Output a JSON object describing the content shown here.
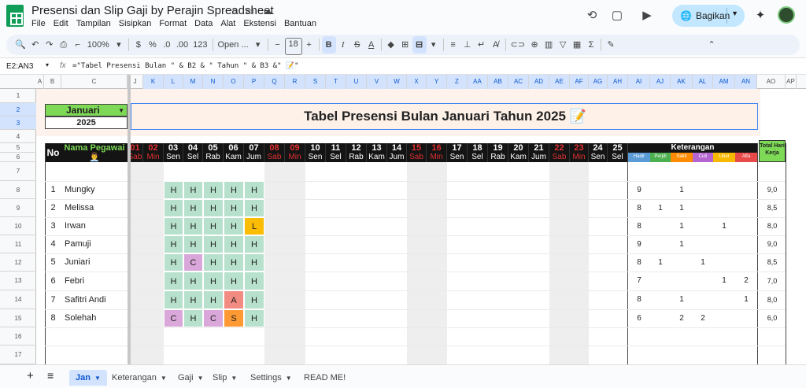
{
  "doc": {
    "title": "Presensi dan Slip Gaji by Perajin Spreadsheet"
  },
  "menu": [
    "File",
    "Edit",
    "Tampilan",
    "Sisipkan",
    "Format",
    "Data",
    "Alat",
    "Ekstensi",
    "Bantuan"
  ],
  "share": {
    "label": "Bagikan"
  },
  "toolbar": {
    "zoom": "100%",
    "currency": "$",
    "percent": "%",
    "dec_less": ".0",
    "dec_more": ".00",
    "number_format": "123",
    "font": "Open ...",
    "font_size": "18",
    "bold": "B"
  },
  "formula_bar": {
    "name_box": "E2:AN3",
    "formula": "=\"Tabel Presensi Bulan \" & B2 & \" Tahun \" & B3 &\" 📝\""
  },
  "columns": [
    "A",
    "B",
    "C",
    "J",
    "K",
    "L",
    "M",
    "N",
    "O",
    "P",
    "Q",
    "R",
    "S",
    "T",
    "U",
    "V",
    "W",
    "X",
    "Y",
    "Z",
    "AA",
    "AB",
    "AC",
    "AD",
    "AE",
    "AF",
    "AG",
    "AH",
    "AI",
    "AJ",
    "AK",
    "AL",
    "AM",
    "AN",
    "AO",
    "AP"
  ],
  "rows": [
    "1",
    "2",
    "3",
    "4",
    "5",
    "6",
    "7",
    "8",
    "9",
    "10",
    "11",
    "12",
    "13",
    "14",
    "15",
    "16",
    "17"
  ],
  "sheet": {
    "month": "Januari",
    "year": "2025",
    "title": "Tabel Presensi Bulan Januari Tahun 2025 📝",
    "no_header": "No",
    "name_header": "Nama Pegawai 👨‍💼",
    "days": [
      {
        "n": "01",
        "d": "Sab",
        "holiday": true
      },
      {
        "n": "02",
        "d": "Min",
        "holiday": true
      },
      {
        "n": "03",
        "d": "Sen"
      },
      {
        "n": "04",
        "d": "Sel"
      },
      {
        "n": "05",
        "d": "Rab"
      },
      {
        "n": "06",
        "d": "Kam"
      },
      {
        "n": "07",
        "d": "Jum"
      },
      {
        "n": "08",
        "d": "Sab",
        "holiday": true
      },
      {
        "n": "09",
        "d": "Min",
        "holiday": true
      },
      {
        "n": "10",
        "d": "Sen"
      },
      {
        "n": "11",
        "d": "Sel"
      },
      {
        "n": "12",
        "d": "Rab"
      },
      {
        "n": "13",
        "d": "Kam"
      },
      {
        "n": "14",
        "d": "Jum"
      },
      {
        "n": "15",
        "d": "Sab",
        "holiday": true
      },
      {
        "n": "16",
        "d": "Min",
        "holiday": true
      },
      {
        "n": "17",
        "d": "Sen"
      },
      {
        "n": "18",
        "d": "Sel"
      },
      {
        "n": "19",
        "d": "Rab"
      },
      {
        "n": "20",
        "d": "Kam"
      },
      {
        "n": "21",
        "d": "Jum"
      },
      {
        "n": "22",
        "d": "Sab",
        "holiday": true
      },
      {
        "n": "23",
        "d": "Min",
        "holiday": true
      },
      {
        "n": "24",
        "d": "Sen"
      },
      {
        "n": "25",
        "d": "Sel"
      }
    ],
    "keterangan": {
      "title": "Keterangan",
      "labels": [
        "Hadir",
        "Perjdl",
        "Sakit",
        "Cuti",
        "Libur",
        "Alfa"
      ],
      "colors": [
        "#5b9bd5",
        "#4caf50",
        "#ff8c00",
        "#b565d0",
        "#f7b800",
        "#e84a4a"
      ]
    },
    "total_header": "Total Hari Kerja",
    "code_colors": {
      "H": "#b7e1cd",
      "C": "#d9a7d9",
      "L": "#fbbc04",
      "A": "#f28b82",
      "S": "#ff9933"
    },
    "employees": [
      {
        "no": "1",
        "name": "Mungky",
        "marks": [
          "H",
          "H",
          "H",
          "H",
          "H"
        ],
        "ket": [
          "9",
          "",
          "1",
          "",
          "",
          ""
        ],
        "total": "9,0"
      },
      {
        "no": "2",
        "name": "Melissa",
        "marks": [
          "H",
          "H",
          "H",
          "H",
          "H"
        ],
        "ket": [
          "8",
          "1",
          "1",
          "",
          "",
          ""
        ],
        "total": "8,5"
      },
      {
        "no": "3",
        "name": "Irwan",
        "marks": [
          "H",
          "H",
          "H",
          "H",
          "L"
        ],
        "ket": [
          "8",
          "",
          "1",
          "",
          "1",
          ""
        ],
        "total": "8,0"
      },
      {
        "no": "4",
        "name": "Pamuji",
        "marks": [
          "H",
          "H",
          "H",
          "H",
          "H"
        ],
        "ket": [
          "9",
          "",
          "1",
          "",
          "",
          ""
        ],
        "total": "9,0"
      },
      {
        "no": "5",
        "name": "Juniari",
        "marks": [
          "H",
          "C",
          "H",
          "H",
          "H"
        ],
        "ket": [
          "8",
          "1",
          "",
          "1",
          "",
          ""
        ],
        "total": "8,5"
      },
      {
        "no": "6",
        "name": "Febri",
        "marks": [
          "H",
          "H",
          "H",
          "H",
          "H"
        ],
        "ket": [
          "7",
          "",
          "",
          "",
          "1",
          "2"
        ],
        "total": "7,0"
      },
      {
        "no": "7",
        "name": "Safitri Andi",
        "marks": [
          "H",
          "H",
          "H",
          "A",
          "H"
        ],
        "ket": [
          "8",
          "",
          "1",
          "",
          "",
          "1"
        ],
        "total": "8,0"
      },
      {
        "no": "8",
        "name": "Solehah",
        "marks": [
          "C",
          "H",
          "C",
          "S",
          "H"
        ],
        "ket": [
          "6",
          "",
          "2",
          "2",
          "",
          ""
        ],
        "total": "6,0"
      }
    ]
  },
  "tabs": [
    {
      "label": "Jan",
      "active": true
    },
    {
      "label": "Keterangan"
    },
    {
      "label": "Gaji"
    },
    {
      "label": "Slip"
    },
    {
      "label": "Settings"
    },
    {
      "label": "READ ME!"
    }
  ]
}
